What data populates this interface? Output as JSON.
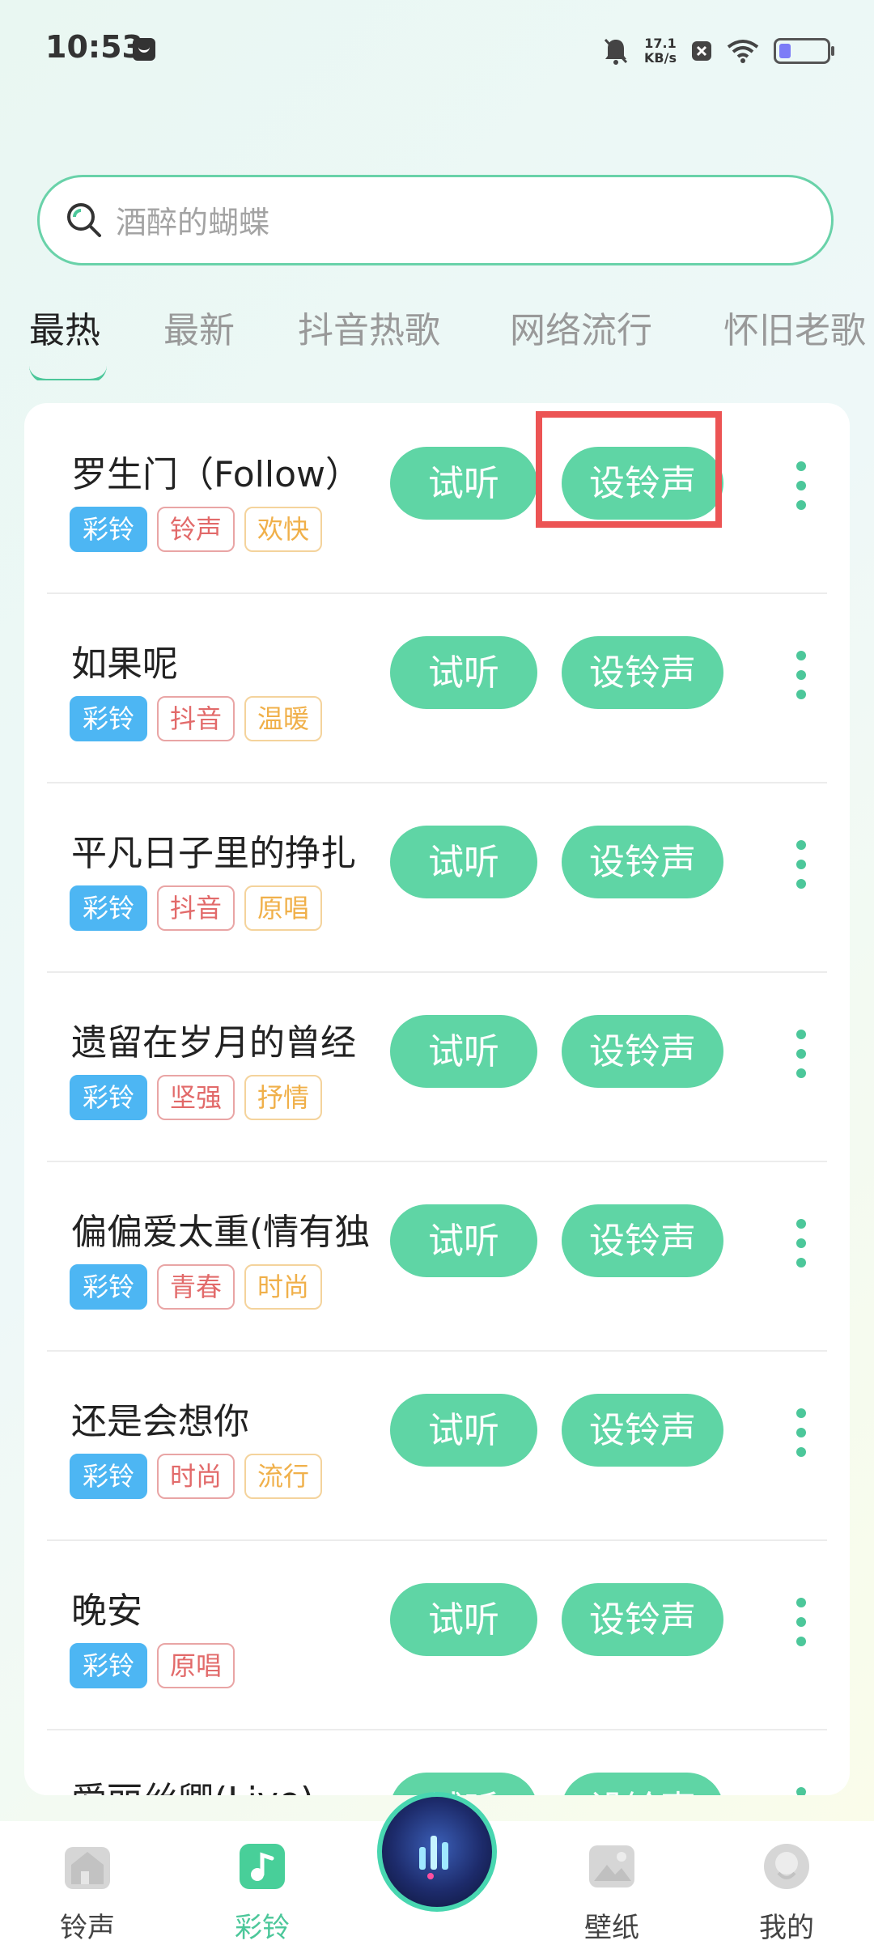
{
  "status_bar": {
    "time": "10:53",
    "speed_value": "17.1",
    "speed_unit": "KB/s"
  },
  "search": {
    "placeholder": "酒醉的蝴蝶"
  },
  "tabs": [
    {
      "label": "最热",
      "active": true
    },
    {
      "label": "最新"
    },
    {
      "label": "抖音热歌"
    },
    {
      "label": "网络流行"
    },
    {
      "label": "怀旧老歌"
    }
  ],
  "buttons": {
    "preview": "试听",
    "set_ringtone": "设铃声"
  },
  "songs": [
    {
      "title": "罗生门（Follow）",
      "tags": [
        "彩铃",
        "铃声",
        "欢快"
      ]
    },
    {
      "title": "如果呢",
      "tags": [
        "彩铃",
        "抖音",
        "温暖"
      ]
    },
    {
      "title": "平凡日子里的挣扎",
      "tags": [
        "彩铃",
        "抖音",
        "原唱"
      ]
    },
    {
      "title": "遗留在岁月的曾经",
      "tags": [
        "彩铃",
        "坚强",
        "抒情"
      ]
    },
    {
      "title": "偏偏爱太重(情有独",
      "tags": [
        "彩铃",
        "青春",
        "时尚"
      ]
    },
    {
      "title": "还是会想你",
      "tags": [
        "彩铃",
        "时尚",
        "流行"
      ]
    },
    {
      "title": "晚安",
      "tags": [
        "彩铃",
        "原唱"
      ]
    },
    {
      "title": "爱丽丝卿(Live)",
      "tags": []
    }
  ],
  "bottom_nav": [
    {
      "label": "铃声"
    },
    {
      "label": "彩铃",
      "active": true
    },
    {
      "label": "壁纸"
    },
    {
      "label": "我的"
    }
  ],
  "colors": {
    "accent": "#5fd5a5",
    "tag_blue": "#4db6f3",
    "tag_red": "#e26a6a",
    "tag_orange": "#f0b04a",
    "highlight": "#ec5454"
  }
}
